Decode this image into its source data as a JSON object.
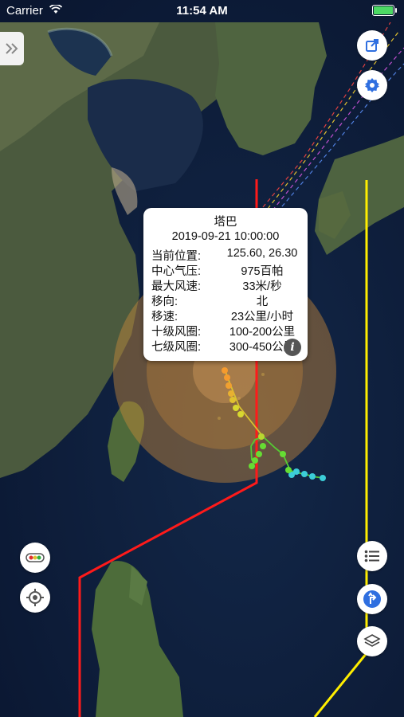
{
  "status_bar": {
    "carrier": "Carrier",
    "time": "11:54 AM",
    "battery_color": "#4cd964"
  },
  "typhoon_popup": {
    "title": "塔巴",
    "datetime": "2019-09-21 10:00:00",
    "rows": [
      {
        "label": "当前位置:",
        "value": "125.60, 26.30"
      },
      {
        "label": "中心气压:",
        "value": "975百帕"
      },
      {
        "label": "最大风速:",
        "value": "33米/秒"
      },
      {
        "label": "移向:",
        "value": "北"
      },
      {
        "label": "移速:",
        "value": "23公里/小时"
      },
      {
        "label": "十级风圈:",
        "value": "100-200公里"
      },
      {
        "label": "七级风圈:",
        "value": "300-450公里"
      }
    ],
    "info_icon": "i"
  },
  "controls": {
    "left": [
      "expand-panel-icon",
      "traffic-legend-icon",
      "locate-icon"
    ],
    "right": [
      "share-icon",
      "settings-icon",
      "list-icon",
      "route-icon",
      "layers-icon"
    ]
  },
  "colors": {
    "warning_line_24h": "#ff1a1a",
    "warning_line_48h": "#ffee00",
    "wind_circle": "#c98a3a",
    "track_orange": "#f59a2e",
    "track_yellow": "#d8d830",
    "track_green": "#66dd33",
    "track_cyan": "#3ccdd8",
    "accent_blue": "#2f6fe0"
  }
}
